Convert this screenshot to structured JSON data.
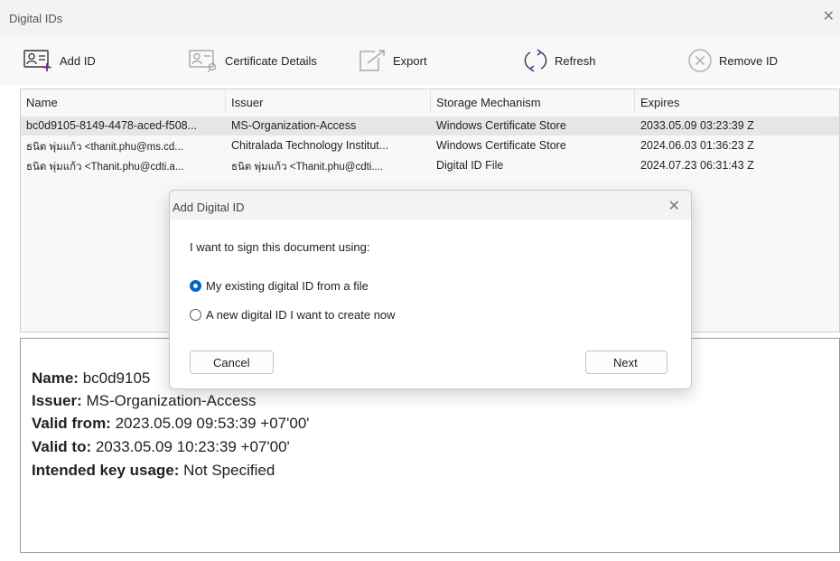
{
  "window": {
    "title": "Digital IDs",
    "close_glyph": "✕"
  },
  "toolbar": {
    "add_id": "Add ID",
    "certificate_details": "Certificate Details",
    "export": "Export",
    "refresh": "Refresh",
    "remove_id": "Remove ID"
  },
  "table": {
    "columns": [
      "Name",
      "Issuer",
      "Storage Mechanism",
      "Expires"
    ],
    "rows": [
      {
        "name": "bc0d9105-8149-4478-aced-f508...",
        "issuer": "MS-Organization-Access",
        "storage": "Windows Certificate Store",
        "expires": "2033.05.09 03:23:39 Z"
      },
      {
        "name": "ธนิต พุ่มแก้ว <thanit.phu@ms.cd...",
        "issuer": "Chitralada Technology Institut...",
        "storage": "Windows Certificate Store",
        "expires": "2024.06.03 01:36:23 Z"
      },
      {
        "name": "ธนิต พุ่มแก้ว <Thanit.phu@cdti.a...",
        "issuer": "ธนิต พุ่มแก้ว <Thanit.phu@cdti....",
        "storage": "Digital ID File",
        "expires": "2024.07.23 06:31:43 Z"
      }
    ]
  },
  "details": {
    "name_label": "Name:",
    "name_value": " bc0d9105",
    "issuer_label": "Issuer:",
    "issuer_value": " MS-Organization-Access",
    "valid_from_label": "Valid from:",
    "valid_from_value": " 2023.05.09 09:53:39 +07'00'",
    "valid_to_label": "Valid to:",
    "valid_to_value": " 2033.05.09 10:23:39 +07'00'",
    "usage_label": "Intended key usage:",
    "usage_value": " Not Specified"
  },
  "dialog": {
    "title": "Add Digital ID",
    "close_glyph": "✕",
    "prompt": "I want to sign this document using:",
    "option_existing": "My existing digital ID from a file",
    "option_new": "A new digital ID I want to create now",
    "cancel": "Cancel",
    "next": "Next",
    "selected_option": "existing"
  },
  "colors": {
    "accent": "#0067c0",
    "icon_purple": "#6b2c91",
    "icon_gray": "#9b9b9b"
  }
}
